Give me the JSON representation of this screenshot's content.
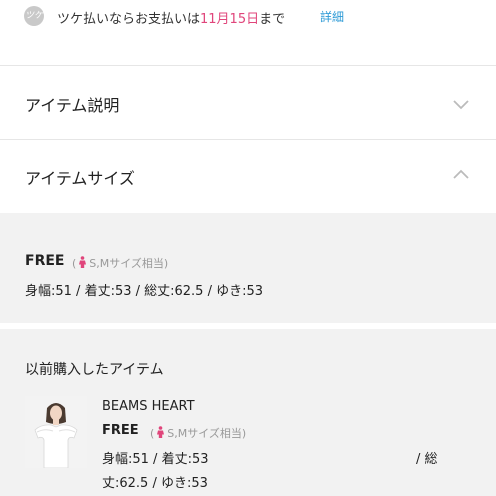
{
  "payment": {
    "logo_text": "ツケ",
    "text_before": "ツケ払いならお支払いは",
    "date": "11月15日",
    "text_after": "まで",
    "link": "詳細",
    "date_color": "#e0457b",
    "link_color": "#2c9ad6"
  },
  "accordion": [
    {
      "title": "アイテム説明",
      "state": "collapsed",
      "icon": "chevron-down-icon"
    },
    {
      "title": "アイテムサイズ",
      "state": "expanded",
      "icon": "chevron-up-icon"
    }
  ],
  "item_size": {
    "name": "FREE",
    "note_prefix": "(",
    "note": "S,Mサイズ相当)",
    "measurements": "身幅:51 / 着丈:53 / 総丈:62.5 / ゆき:53"
  },
  "history": {
    "title": "以前購入したアイテム",
    "product": {
      "brand": "BEAMS HEART",
      "size": "FREE",
      "note_prefix": "(",
      "note": "S,Mサイズ相当)",
      "meas_line1": "身幅:51 / 着丈:53",
      "meas_line1_end": "/ 総",
      "meas_line2": "丈:62.5 / ゆき:53"
    }
  },
  "colors": {
    "background_gray": "#f2f2f2",
    "person_icon": "#e0457b"
  }
}
